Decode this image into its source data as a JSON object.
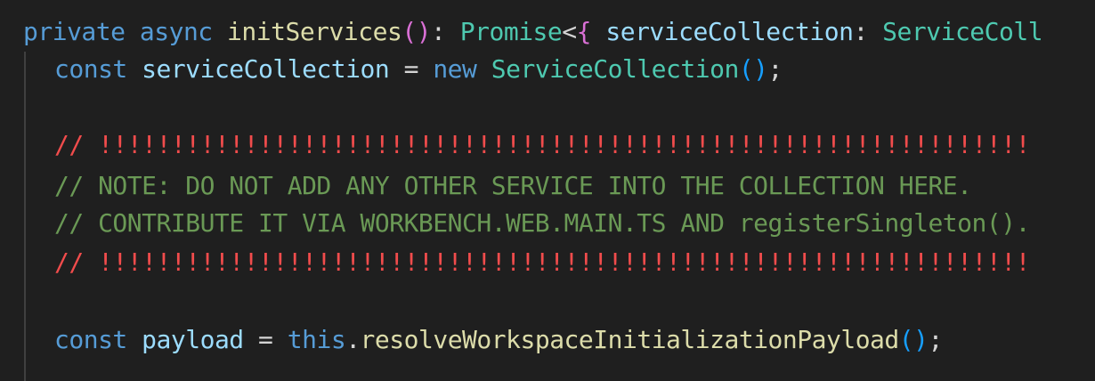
{
  "editor": {
    "lines": [
      {
        "tokens": [
          {
            "text": "private",
            "kind": "keyword"
          },
          {
            "text": " "
          },
          {
            "text": "async",
            "kind": "keyword"
          },
          {
            "text": " "
          },
          {
            "text": "initServices",
            "kind": "function"
          },
          {
            "text": "(",
            "kind": "paren"
          },
          {
            "text": ")",
            "kind": "paren"
          },
          {
            "text": ": "
          },
          {
            "text": "Promise",
            "kind": "type"
          },
          {
            "text": "<"
          },
          {
            "text": "{",
            "kind": "brace"
          },
          {
            "text": " "
          },
          {
            "text": "serviceCollection",
            "kind": "variable"
          },
          {
            "text": ": "
          },
          {
            "text": "ServiceColl",
            "kind": "type"
          }
        ]
      },
      {
        "tokens": [
          {
            "text": "const",
            "kind": "keyword"
          },
          {
            "text": " "
          },
          {
            "text": "serviceCollection",
            "kind": "variable"
          },
          {
            "text": " = "
          },
          {
            "text": "new",
            "kind": "keyword"
          },
          {
            "text": " "
          },
          {
            "text": "ServiceCollection",
            "kind": "type"
          },
          {
            "text": "()",
            "kind": "call-paren"
          },
          {
            "text": ";"
          }
        ]
      },
      {
        "tokens": []
      },
      {
        "tokens": [
          {
            "text": "// ",
            "kind": "comment-bang"
          },
          {
            "text": "!!!!!!!!!!!!!!!!!!!!!!!!!!!!!!!!!!!!!!!!!!!!!!!!!!!!!!!!!!!!!!!!",
            "kind": "comment-bang"
          }
        ]
      },
      {
        "tokens": [
          {
            "text": "// NOTE: DO NOT ADD ANY OTHER SERVICE INTO THE COLLECTION HERE.",
            "kind": "comment"
          }
        ]
      },
      {
        "tokens": [
          {
            "text": "// CONTRIBUTE IT VIA WORKBENCH.WEB.MAIN.TS AND registerSingleton().",
            "kind": "comment"
          }
        ]
      },
      {
        "tokens": [
          {
            "text": "// ",
            "kind": "comment-bang"
          },
          {
            "text": "!!!!!!!!!!!!!!!!!!!!!!!!!!!!!!!!!!!!!!!!!!!!!!!!!!!!!!!!!!!!!!!!",
            "kind": "comment-bang"
          }
        ]
      },
      {
        "tokens": []
      },
      {
        "tokens": [
          {
            "text": "const",
            "kind": "keyword"
          },
          {
            "text": " "
          },
          {
            "text": "payload",
            "kind": "variable"
          },
          {
            "text": " = "
          },
          {
            "text": "this",
            "kind": "keyword"
          },
          {
            "text": "."
          },
          {
            "text": "resolveWorkspaceInitializationPayload",
            "kind": "function"
          },
          {
            "text": "()",
            "kind": "call-paren"
          },
          {
            "text": ";"
          }
        ]
      }
    ]
  }
}
